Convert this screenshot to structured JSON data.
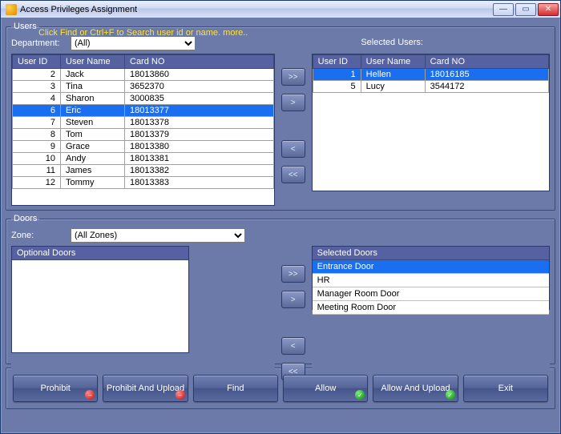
{
  "window": {
    "title": "Access Privileges Assignment"
  },
  "users": {
    "legend": "Users",
    "hint": "Click Find or Ctrl+F  to Search user id or name.  more..",
    "department_label": "Department:",
    "department_value": "(All)",
    "columns": {
      "id": "User ID",
      "name": "User Name",
      "card": "Card NO"
    },
    "rows": [
      {
        "id": "2",
        "name": "Jack",
        "card": "18013860",
        "selected": false
      },
      {
        "id": "3",
        "name": "Tina",
        "card": "3652370",
        "selected": false
      },
      {
        "id": "4",
        "name": "Sharon",
        "card": "3000835",
        "selected": false
      },
      {
        "id": "6",
        "name": "Eric",
        "card": "18013377",
        "selected": true
      },
      {
        "id": "7",
        "name": "Steven",
        "card": "18013378",
        "selected": false
      },
      {
        "id": "8",
        "name": "Tom",
        "card": "18013379",
        "selected": false
      },
      {
        "id": "9",
        "name": "Grace",
        "card": "18013380",
        "selected": false
      },
      {
        "id": "10",
        "name": "Andy",
        "card": "18013381",
        "selected": false
      },
      {
        "id": "11",
        "name": "James",
        "card": "18013382",
        "selected": false
      },
      {
        "id": "12",
        "name": "Tommy",
        "card": "18013383",
        "selected": false
      }
    ],
    "selected_label": "Selected Users:",
    "selected_rows": [
      {
        "id": "1",
        "name": "Hellen",
        "card": "18016185",
        "selected": true
      },
      {
        "id": "5",
        "name": "Lucy",
        "card": "3544172",
        "selected": false
      }
    ],
    "move": {
      "add_all": ">>",
      "add": ">",
      "remove": "<",
      "remove_all": "<<"
    }
  },
  "doors": {
    "legend": "Doors",
    "zone_label": "Zone:",
    "zone_value": "(All Zones)",
    "optional_header": "Optional Doors",
    "selected_header": "Selected Doors",
    "selected_items": [
      {
        "label": "Entrance Door",
        "selected": true
      },
      {
        "label": "HR",
        "selected": false
      },
      {
        "label": "Manager Room  Door",
        "selected": false
      },
      {
        "label": "Meeting Room Door",
        "selected": false
      }
    ],
    "move": {
      "add_all": ">>",
      "add": ">",
      "remove": "<",
      "remove_all": "<<"
    }
  },
  "actions": {
    "prohibit": "Prohibit",
    "prohibit_upload": "Prohibit And Upload",
    "find": "Find",
    "allow": "Allow",
    "allow_upload": "Allow And Upload",
    "exit": "Exit"
  }
}
